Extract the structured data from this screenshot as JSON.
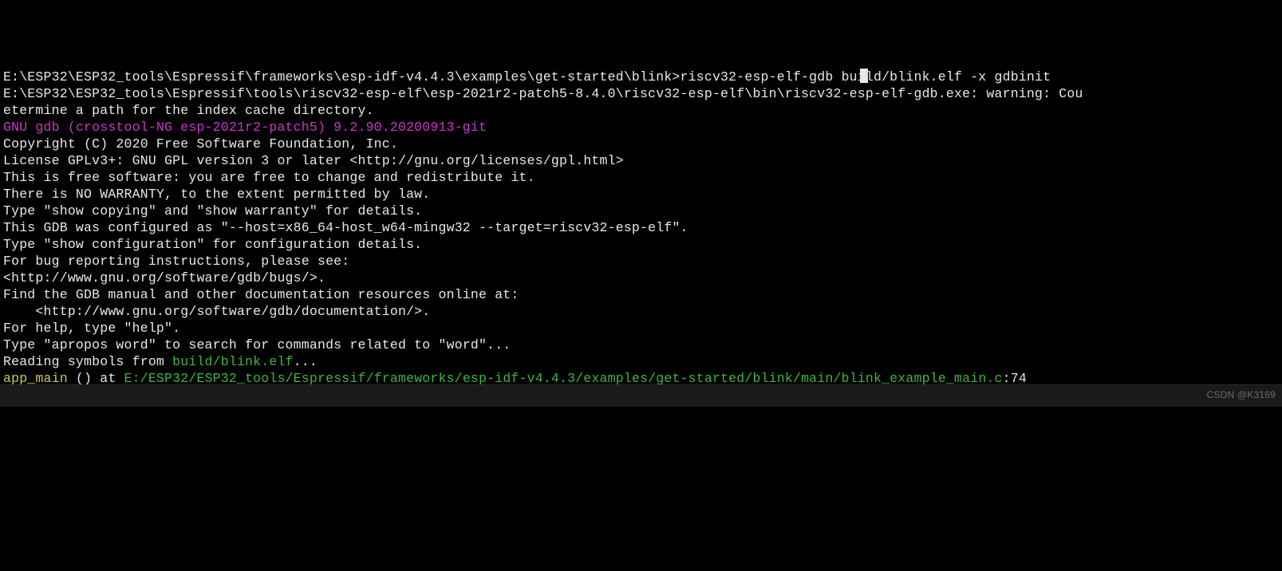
{
  "terminal": {
    "lines": [
      {
        "segments": [
          {
            "cls": "white",
            "text": "E:\\ESP32\\ESP32_tools\\Espressif\\frameworks\\esp-idf-v4.4.3\\examples\\get-started\\blink>riscv32-esp-elf-gdb build/blink.elf -x gdbinit"
          }
        ]
      },
      {
        "segments": [
          {
            "cls": "white",
            "text": "E:\\ESP32\\ESP32_tools\\Espressif\\tools\\riscv32-esp-elf\\esp-2021r2-patch5-8.4.0\\riscv32-esp-elf\\bin\\riscv32-esp-elf-gdb.exe: warning: Cou"
          }
        ]
      },
      {
        "segments": [
          {
            "cls": "white",
            "text": "etermine a path for the index cache directory."
          }
        ]
      },
      {
        "segments": [
          {
            "cls": "magenta",
            "text": "GNU gdb (crosstool-NG esp-2021r2-patch5) 9.2.90.20200913-git"
          }
        ]
      },
      {
        "segments": [
          {
            "cls": "white",
            "text": "Copyright (C) 2020 Free Software Foundation, Inc."
          }
        ]
      },
      {
        "segments": [
          {
            "cls": "white",
            "text": "License GPLv3+: GNU GPL version 3 or later <http://gnu.org/licenses/gpl.html>"
          }
        ]
      },
      {
        "segments": [
          {
            "cls": "white",
            "text": "This is free software: you are free to change and redistribute it."
          }
        ]
      },
      {
        "segments": [
          {
            "cls": "white",
            "text": "There is NO WARRANTY, to the extent permitted by law."
          }
        ]
      },
      {
        "segments": [
          {
            "cls": "white",
            "text": "Type \"show copying\" and \"show warranty\" for details."
          }
        ]
      },
      {
        "segments": [
          {
            "cls": "white",
            "text": "This GDB was configured as \"--host=x86_64-host_w64-mingw32 --target=riscv32-esp-elf\"."
          }
        ]
      },
      {
        "segments": [
          {
            "cls": "white",
            "text": "Type \"show configuration\" for configuration details."
          }
        ]
      },
      {
        "segments": [
          {
            "cls": "white",
            "text": "For bug reporting instructions, please see:"
          }
        ]
      },
      {
        "segments": [
          {
            "cls": "white",
            "text": "<http://www.gnu.org/software/gdb/bugs/>."
          }
        ]
      },
      {
        "segments": [
          {
            "cls": "white",
            "text": "Find the GDB manual and other documentation resources online at:"
          }
        ]
      },
      {
        "segments": [
          {
            "cls": "white",
            "text": "    <http://www.gnu.org/software/gdb/documentation/>."
          }
        ]
      },
      {
        "segments": [
          {
            "cls": "white",
            "text": ""
          }
        ]
      },
      {
        "segments": [
          {
            "cls": "white",
            "text": "For help, type \"help\"."
          }
        ]
      },
      {
        "segments": [
          {
            "cls": "white",
            "text": "Type \"apropos word\" to search for commands related to \"word\"..."
          }
        ]
      },
      {
        "segments": [
          {
            "cls": "white",
            "text": "Reading symbols from "
          },
          {
            "cls": "green",
            "text": "build/blink.elf"
          },
          {
            "cls": "white",
            "text": "..."
          }
        ]
      },
      {
        "segments": [
          {
            "cls": "yellow",
            "text": "app_main "
          },
          {
            "cls": "white",
            "text": "() at "
          },
          {
            "cls": "green",
            "text": "E:/ESP32/ESP32_tools/Espressif/frameworks/esp-idf-v4.4.3/examples/get-started/blink/main/blink_example_main.c"
          },
          {
            "cls": "white",
            "text": ":74"
          }
        ]
      }
    ]
  },
  "watermark": "CSDN @K3169"
}
